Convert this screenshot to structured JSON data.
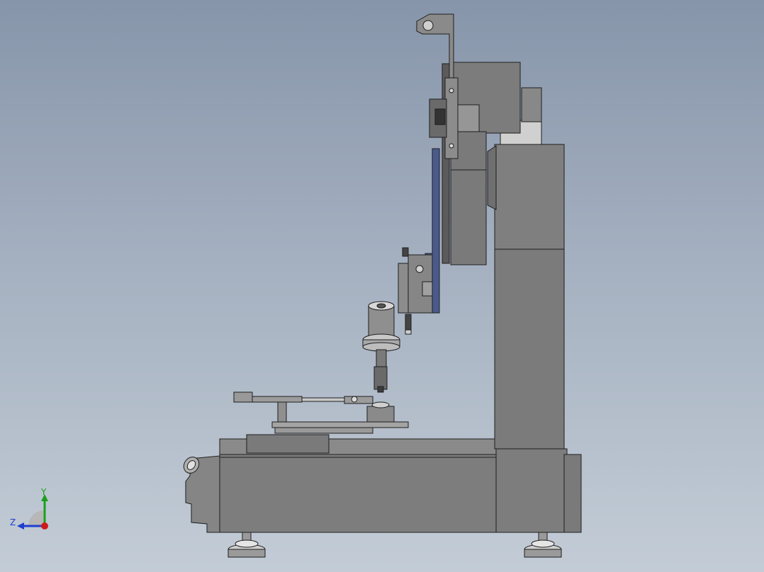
{
  "viewport": {
    "background_top": "#8795aa",
    "background_bottom": "#c3ccd6"
  },
  "triad": {
    "y_label": "Y",
    "z_label": "Z",
    "y_color": "#1aa01a",
    "z_color": "#1f3fd0",
    "x_color": "#d01a1a"
  },
  "model": {
    "body_color": "#7d7d7d",
    "edge_color": "#1e1e1e",
    "slide_color": "#4b5a8c",
    "highlight_color": "#b9b9b9"
  }
}
